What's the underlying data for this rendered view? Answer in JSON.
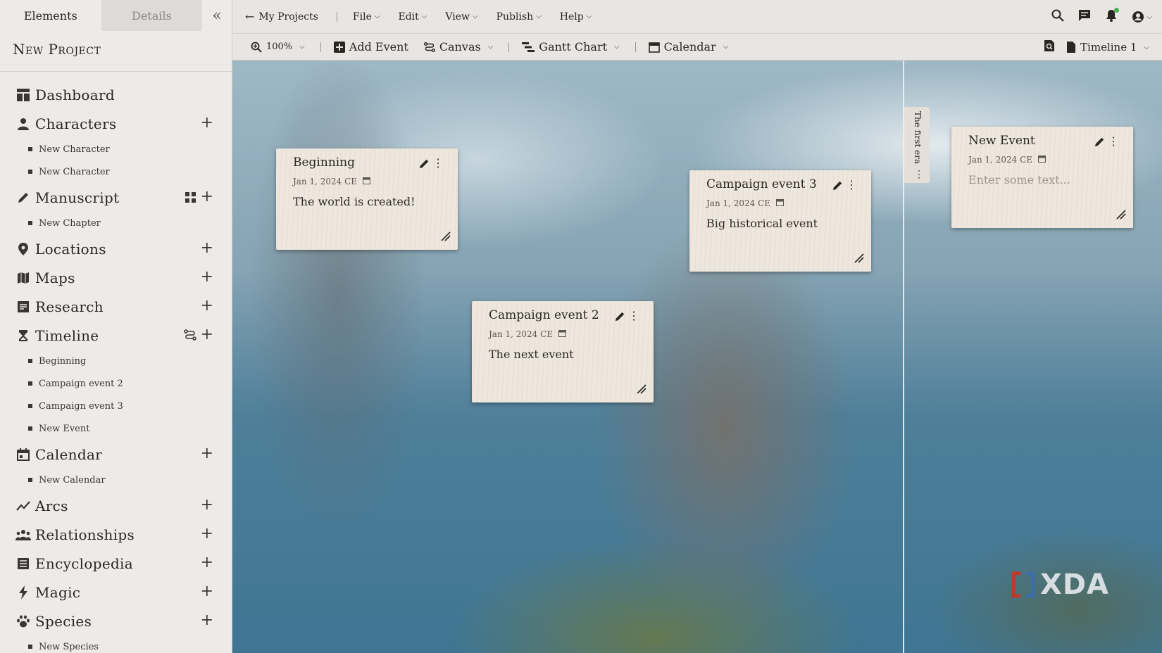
{
  "sidebar": {
    "tabs": [
      "Elements",
      "Details"
    ],
    "collapse_icon": "«",
    "project_title": "New Project",
    "items": [
      {
        "label": "Dashboard",
        "icon": "dashboard-icon",
        "plus": false,
        "subitems": []
      },
      {
        "label": "Characters",
        "icon": "person-icon",
        "plus": true,
        "subitems": [
          "New Character",
          "New Character"
        ]
      },
      {
        "label": "Manuscript",
        "icon": "pen-icon",
        "plus": true,
        "extra": "grid-icon",
        "subitems": [
          "New Chapter"
        ]
      },
      {
        "label": "Locations",
        "icon": "map-pin-icon",
        "plus": true,
        "subitems": []
      },
      {
        "label": "Maps",
        "icon": "map-icon",
        "plus": true,
        "subitems": []
      },
      {
        "label": "Research",
        "icon": "note-icon",
        "plus": true,
        "subitems": []
      },
      {
        "label": "Timeline",
        "icon": "hourglass-icon",
        "plus": true,
        "extra": "route-icon",
        "subitems": [
          "Beginning",
          "Campaign event 2",
          "Campaign event 3",
          "New Event"
        ]
      },
      {
        "label": "Calendar",
        "icon": "calendar-icon",
        "plus": true,
        "subitems": [
          "New Calendar"
        ]
      },
      {
        "label": "Arcs",
        "icon": "trend-icon",
        "plus": true,
        "subitems": []
      },
      {
        "label": "Relationships",
        "icon": "group-icon",
        "plus": true,
        "subitems": []
      },
      {
        "label": "Encyclopedia",
        "icon": "book-icon",
        "plus": true,
        "subitems": []
      },
      {
        "label": "Magic",
        "icon": "bolt-icon",
        "plus": true,
        "subitems": []
      },
      {
        "label": "Species",
        "icon": "paw-icon",
        "plus": true,
        "subitems": [
          "New Species"
        ]
      }
    ]
  },
  "menubar": {
    "back_label": "My Projects",
    "menus": [
      "File",
      "Edit",
      "View",
      "Publish",
      "Help"
    ]
  },
  "toolbar": {
    "zoom": "100%",
    "add_event": "Add Event",
    "canvas": "Canvas",
    "gantt": "Gantt Chart",
    "calendar": "Calendar",
    "timeline_select": "Timeline 1"
  },
  "canvas": {
    "era_label": "The first era",
    "events": [
      {
        "title": "Beginning",
        "date": "Jan 1, 2024 CE",
        "description": "The world is created!",
        "placeholder": false
      },
      {
        "title": "Campaign event 2",
        "date": "Jan 1, 2024 CE",
        "description": "The next event",
        "placeholder": false
      },
      {
        "title": "Campaign event 3",
        "date": "Jan 1, 2024 CE",
        "description": "Big historical event",
        "placeholder": false
      },
      {
        "title": "New Event",
        "date": "Jan 1, 2024 CE",
        "description": "Enter some text...",
        "placeholder": true
      }
    ]
  },
  "watermark": "XDA",
  "colors": {
    "card": "#eee7dd",
    "sidebar": "#ecebea",
    "toolbar": "#e8e6e3",
    "notification_dot": "#4caf50"
  }
}
